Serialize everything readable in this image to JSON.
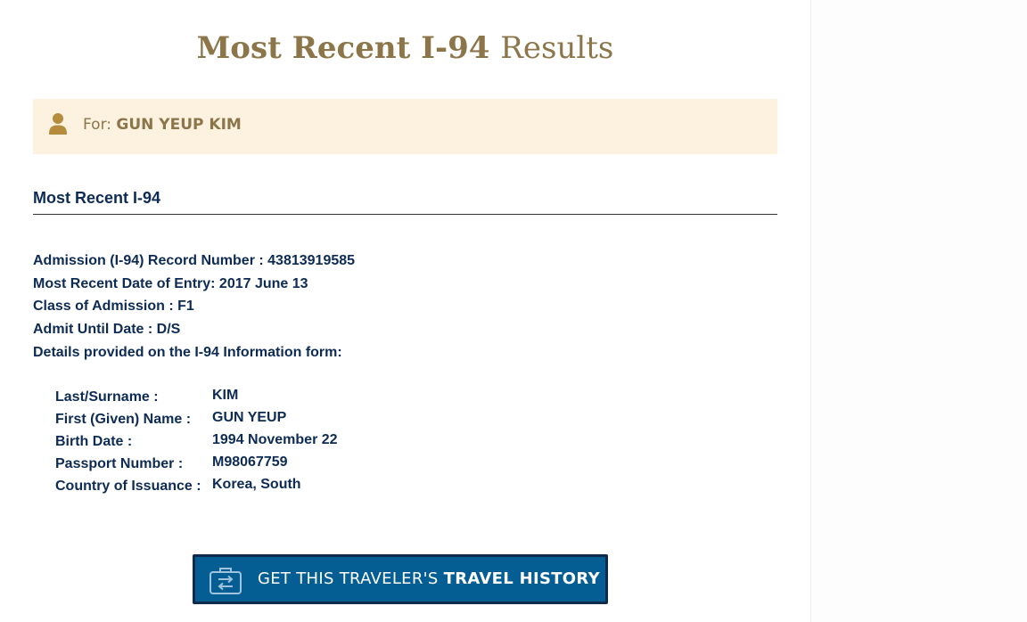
{
  "header": {
    "title_strong": "Most Recent I-94",
    "title_light": "Results"
  },
  "banner": {
    "for_label": "For:",
    "traveler_name": "GUN YEUP KIM",
    "icon": "user-icon"
  },
  "section": {
    "title": "Most Recent I-94"
  },
  "record": {
    "record_number": "Admission (I-94) Record Number : 43813919585",
    "entry_date": "Most Recent Date of Entry: 2017 June 13",
    "class_of_admission": "Class of Admission : F1",
    "admit_until": "Admit Until Date : D/S",
    "details_heading": "Details provided on the I-94 Information form:"
  },
  "form_fields": [
    {
      "label": "Last/Surname :",
      "value": "KIM"
    },
    {
      "label": "First (Given) Name :",
      "value": "GUN YEUP"
    },
    {
      "label": "Birth Date :",
      "value": "1994 November 22"
    },
    {
      "label": "Passport Number :",
      "value": "M98067759"
    },
    {
      "label": "Country of Issuance :",
      "value": "Korea, South"
    }
  ],
  "button": {
    "label_prefix": "GET THIS TRAVELER'S",
    "label_bold": "TRAVEL HISTORY",
    "icon": "travel-history-icon"
  },
  "colors": {
    "title_gold": "#8c7649",
    "banner_bg": "#fdf1e0",
    "text_navy": "#0d2b55",
    "button_blue": "#045e94",
    "button_border": "#0e2b4d"
  }
}
